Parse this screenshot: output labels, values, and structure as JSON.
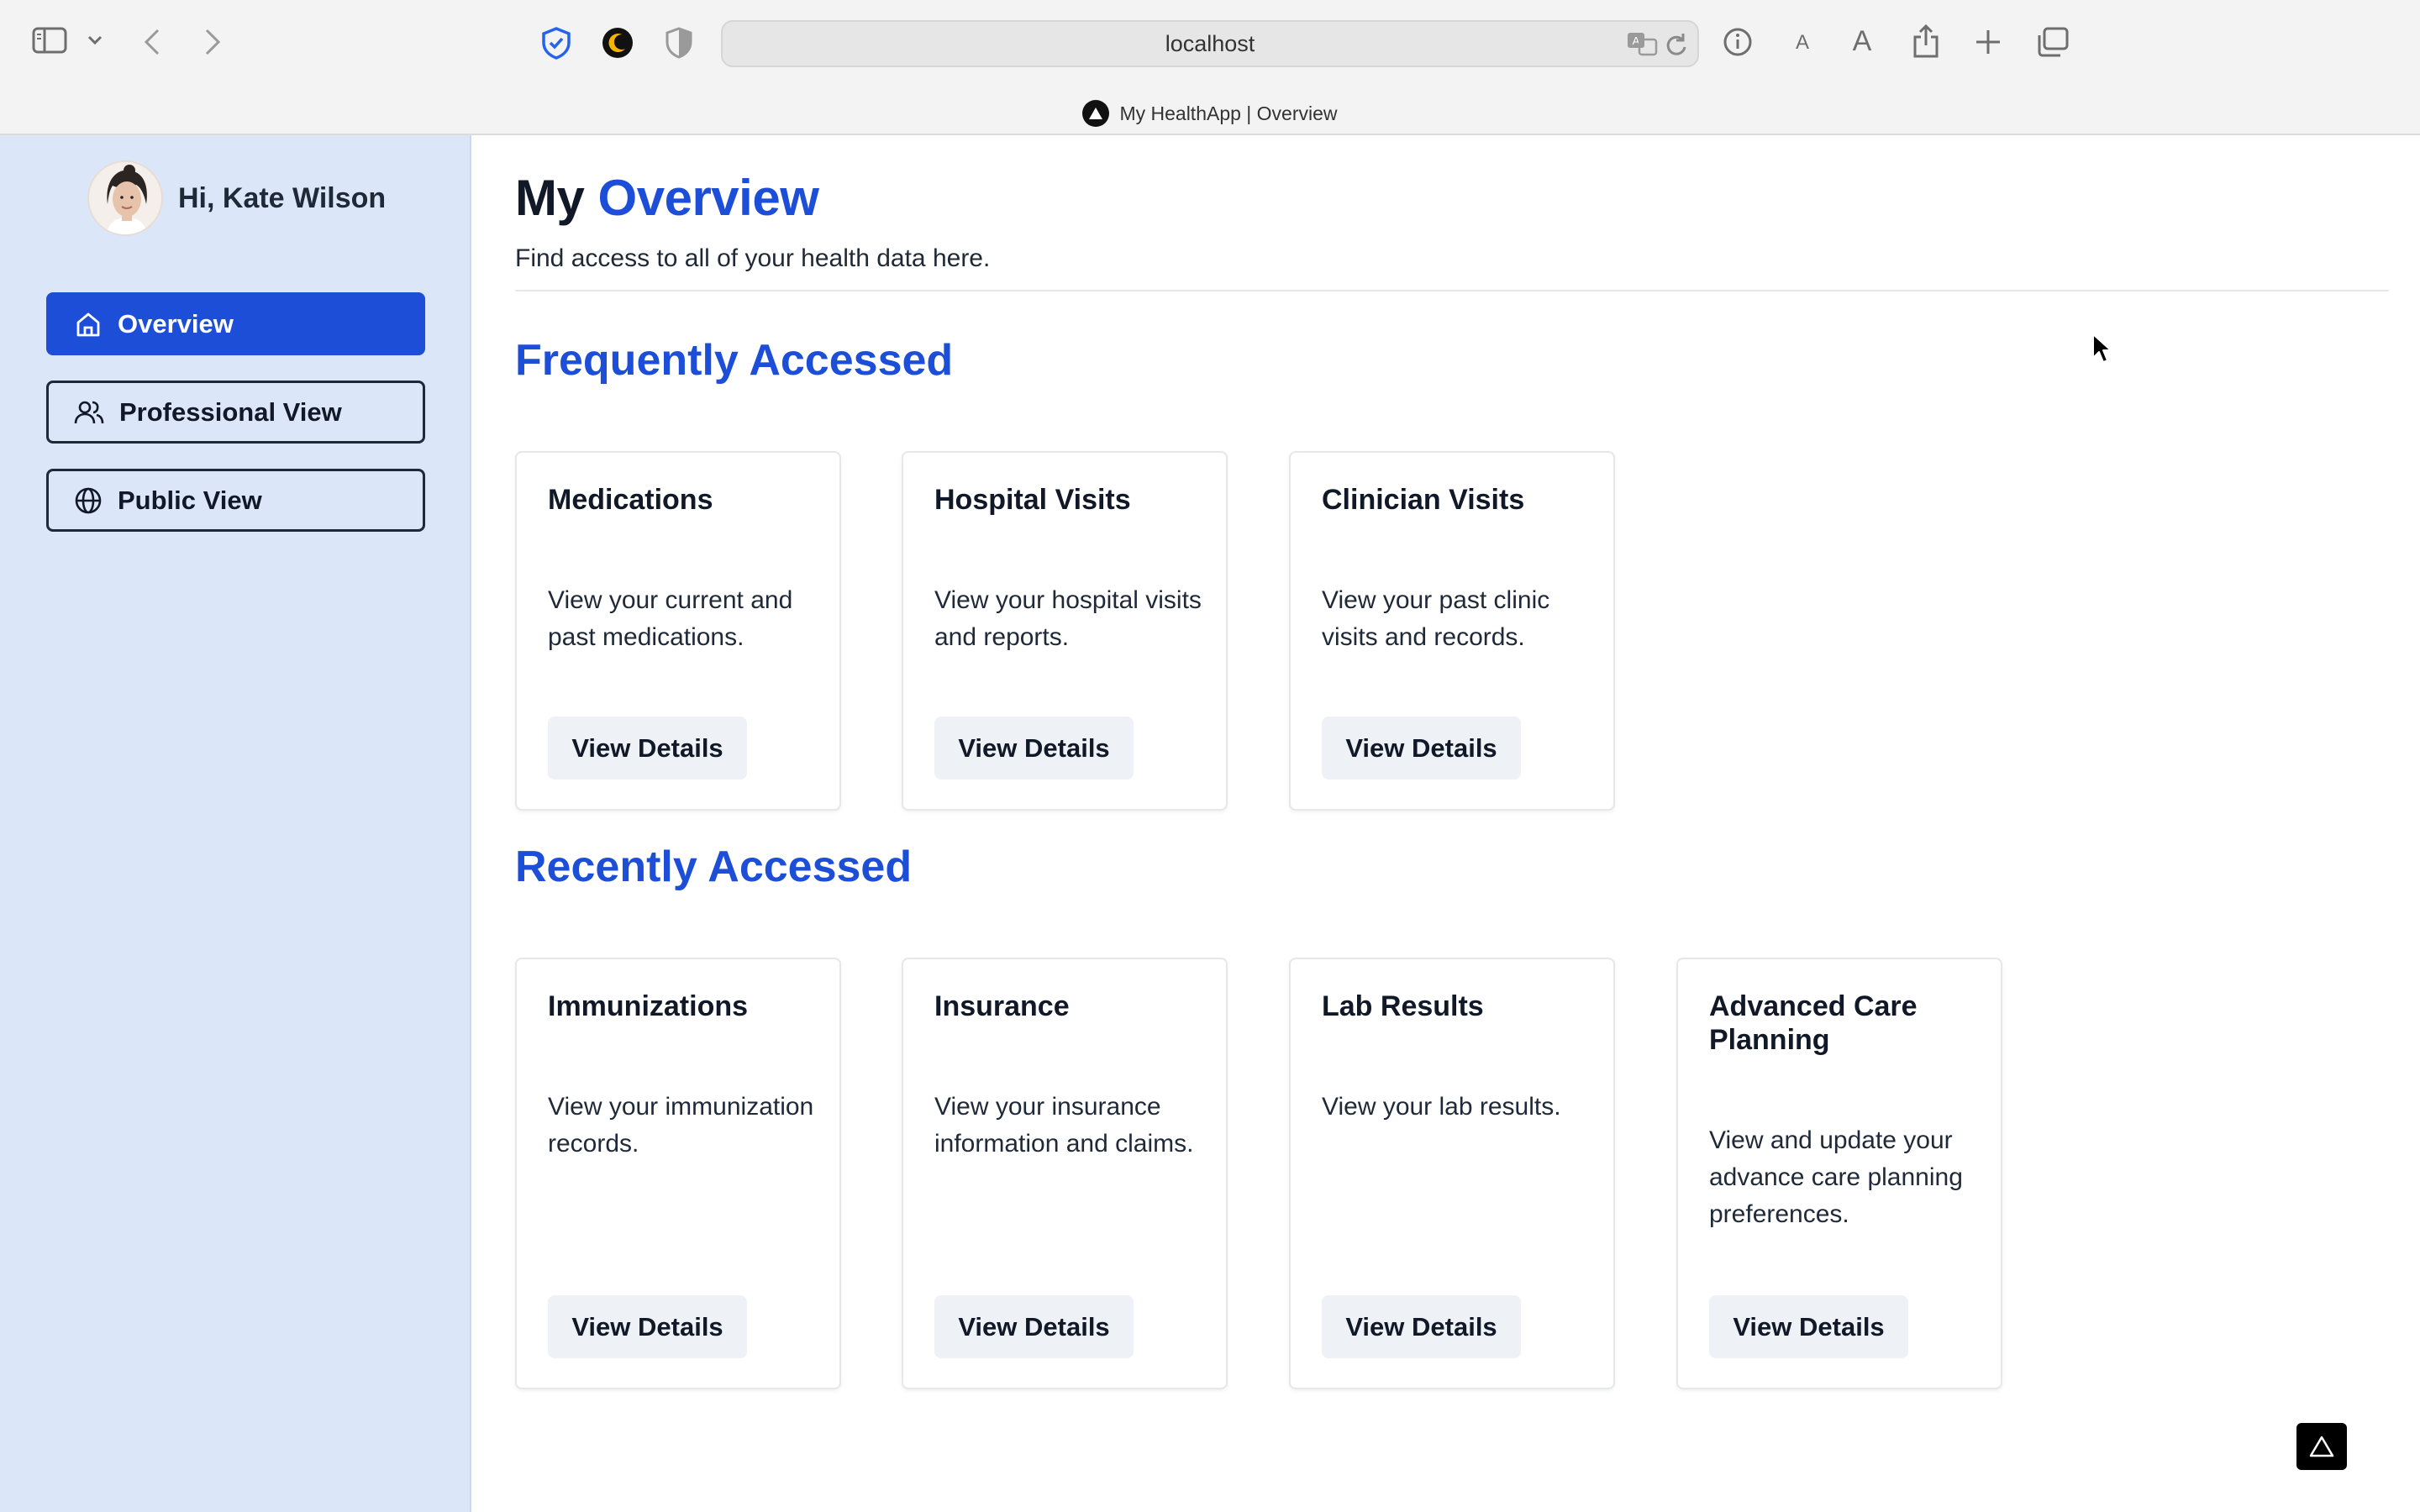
{
  "browser": {
    "url": "localhost",
    "tab_title": "My HealthApp | Overview"
  },
  "sidebar": {
    "greeting": "Hi, Kate Wilson",
    "items": [
      {
        "label": "Overview",
        "icon": "home-icon",
        "active": true
      },
      {
        "label": "Professional View",
        "icon": "users-icon",
        "active": false
      },
      {
        "label": "Public View",
        "icon": "globe-icon",
        "active": false
      }
    ]
  },
  "header": {
    "title_prefix": "My",
    "title_accent": "Overview",
    "subtitle": "Find access to all of your health data here."
  },
  "frequent": {
    "title": "Frequently Accessed",
    "cards": [
      {
        "title": "Medications",
        "desc": "View your current and past medications.",
        "button": "View Details"
      },
      {
        "title": "Hospital Visits",
        "desc": "View your hospital visits and reports.",
        "button": "View Details"
      },
      {
        "title": "Clinician Visits",
        "desc": "View your past clinic visits and records.",
        "button": "View Details"
      }
    ]
  },
  "recent": {
    "title": "Recently Accessed",
    "cards": [
      {
        "title": "Immunizations",
        "desc": "View your immunization records.",
        "button": "View Details"
      },
      {
        "title": "Insurance",
        "desc": "View your insurance information and claims.",
        "button": "View Details"
      },
      {
        "title": "Lab Results",
        "desc": "View your lab results.",
        "button": "View Details"
      },
      {
        "title": "Advanced Care Planning",
        "desc": "View and update your advance care planning preferences.",
        "button": "View Details"
      }
    ]
  },
  "colors": {
    "accent": "#1d4ed8",
    "sidebar_bg": "#dbe7f8",
    "button_bg": "#eef1f5"
  }
}
